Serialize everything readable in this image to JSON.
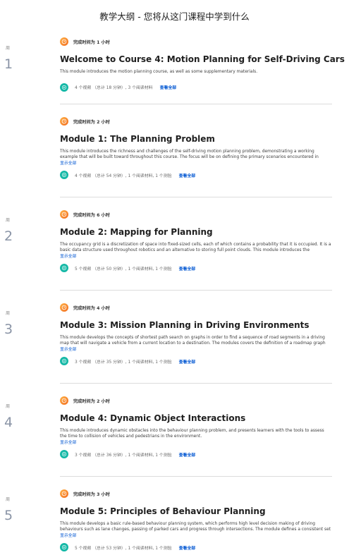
{
  "header": {
    "title": "教学大纲 - 您将从这门课程中学到什么"
  },
  "weeks": [
    {
      "label": "周",
      "number": "1"
    },
    {
      "label": "周",
      "number": "2"
    },
    {
      "label": "周",
      "number": "3"
    },
    {
      "label": "周",
      "number": "4"
    },
    {
      "label": "周",
      "number": "5"
    }
  ],
  "modules": [
    {
      "time": "完成时间为 1 小时",
      "title": "Welcome to Course 4: Motion Planning for Self-Driving Cars",
      "description": "This module introduces the motion planning course, as well as some supplementary materials.",
      "meta": "4 个视频 （总计 18 分钟）, 3 个阅读材料",
      "see_all": "查看全部"
    },
    {
      "time": "完成时间为 2 小时",
      "title": "Module 1: The Planning Problem",
      "description": "This module introduces the richness and challenges of the self-driving motion planning problem, demonstrating a working example that will be built toward throughout this course. The focus will be on defining the primary scenarios encountered in driving, types of loss",
      "show_all": "显示全部",
      "meta": "4 个视频 （总计 54 分钟）, 1 个阅读材料, 1 个测验",
      "see_all": "查看全部"
    },
    {
      "time": "完成时间为 6 小时",
      "title": "Module 2: Mapping for Planning",
      "description": "The occupancy grid is a discretization of space into fixed-sized cells, each of which contains a probability that it is occupied. It is a basic data structure used throughout robotics and an alternative to storing full point clouds. This module introduces the occupancy grid and",
      "show_all": "显示全部",
      "meta": "5 个视频 （总计 50 分钟）, 1 个阅读材料, 1 个测验",
      "see_all": "查看全部"
    },
    {
      "time": "完成时间为 4 小时",
      "title": "Module 3: Mission Planning in Driving Environments",
      "description": "This module develops the concepts of shortest path search on graphs in order to find a sequence of road segments in a driving map that will navigate a vehicle from a current location to a destination. The modules covers the definition of a roadmap graph with road",
      "show_all": "显示全部",
      "meta": "3 个视频 （总计 35 分钟）, 1 个阅读材料, 1 个测验",
      "see_all": "查看全部"
    },
    {
      "time": "完成时间为 2 小时",
      "title": "Module 4: Dynamic Object Interactions",
      "description": "This module introduces dynamic obstacles into the behaviour planning problem, and presents learners with the tools to assess the time to collision of vehicles and pedestrians in the environment.",
      "show_all": "显示全部",
      "meta": "3 个视频 （总计 36 分钟）, 1 个阅读材料, 1 个测验",
      "see_all": "查看全部"
    },
    {
      "time": "完成时间为 3 小时",
      "title": "Module 5: Principles of Behaviour Planning",
      "description": "This module develops a basic rule-based behaviour planning system, which performs high level decision making of driving behaviours such as lane changes, passing of parked cars and progress through intersections. The module defines a consistent set of rules that are",
      "show_all": "显示全部",
      "meta": "5 个视频 （总计 53 分钟）, 1 个阅读材料, 1 个测验",
      "see_all": "查看全部"
    }
  ]
}
